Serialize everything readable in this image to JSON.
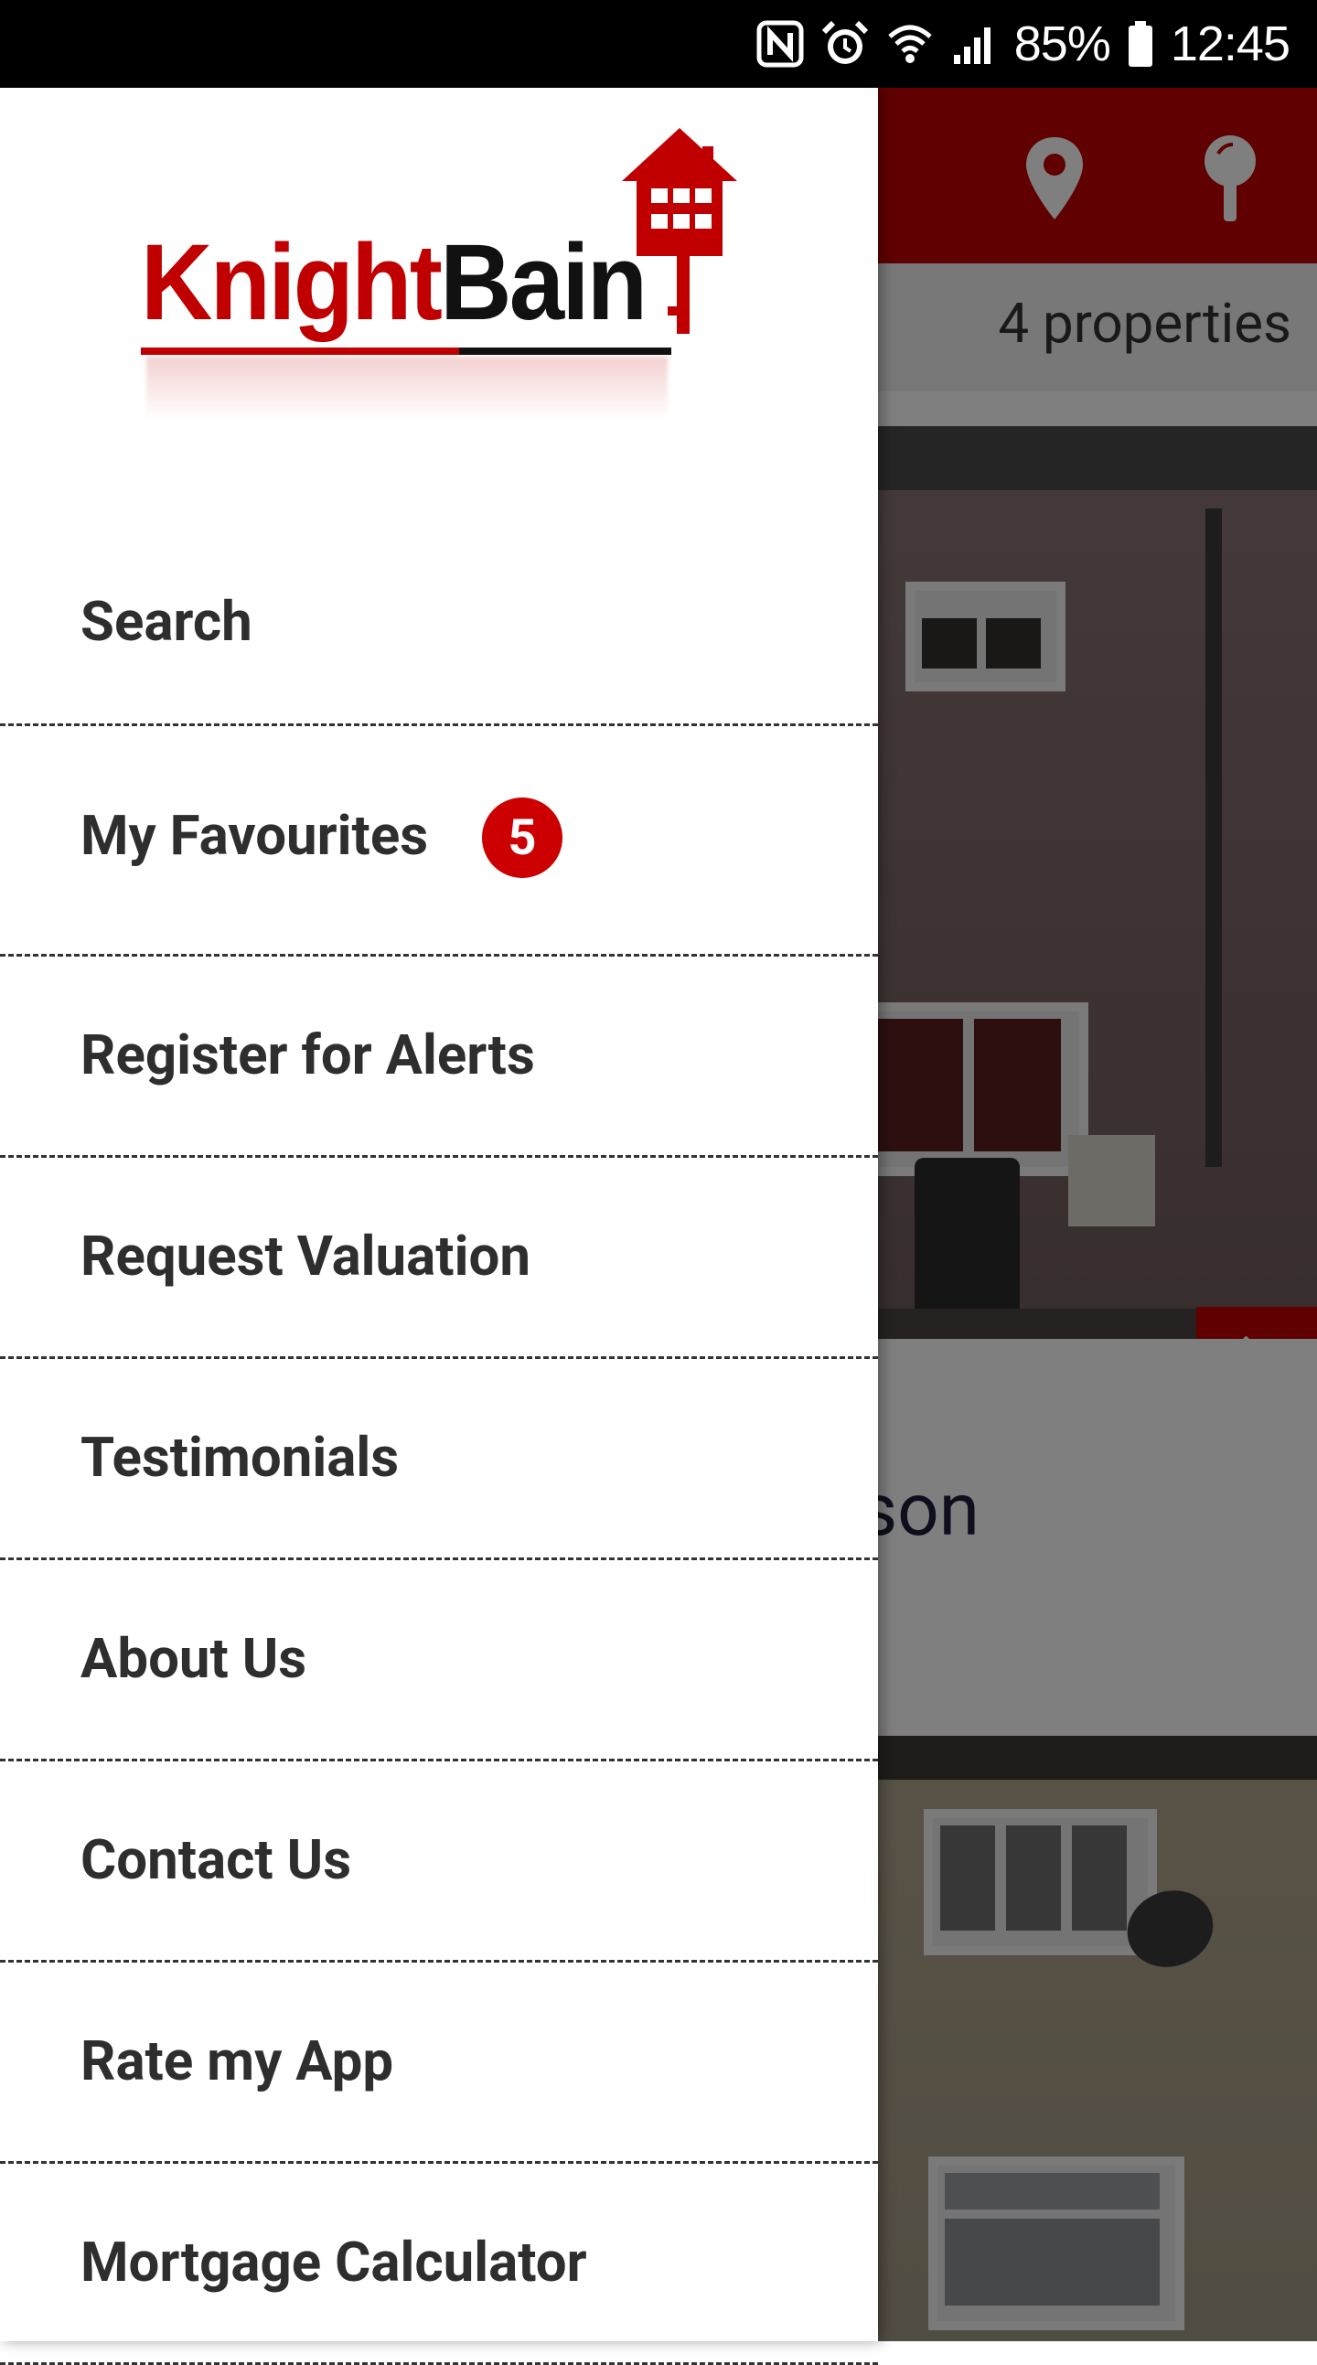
{
  "status_bar": {
    "icons": [
      "nfc-icon",
      "alarm-icon",
      "wifi-icon",
      "signal-icon",
      "battery-icon"
    ],
    "battery": "85%",
    "time": "12:45"
  },
  "app": {
    "toolbar_color": "#c00000",
    "toolbar_icons": [
      "map-pin-icon",
      "search-pin-icon"
    ],
    "properties_count": "4 properties",
    "card_title_partial": "homson"
  },
  "drawer": {
    "logo": {
      "text_part1": "Knight",
      "text_part2": "Bain"
    },
    "items": [
      {
        "label": "Search"
      },
      {
        "label": "My Favourites",
        "badge": "5"
      },
      {
        "label": "Register for Alerts"
      },
      {
        "label": "Request Valuation"
      },
      {
        "label": "Testimonials"
      },
      {
        "label": "About Us"
      },
      {
        "label": "Contact Us"
      },
      {
        "label": "Rate my App"
      },
      {
        "label": "Mortgage Calculator"
      }
    ]
  },
  "colors": {
    "brand_red": "#c00000",
    "badge_red": "#cc0000",
    "menu_text": "#2e2e2e"
  }
}
